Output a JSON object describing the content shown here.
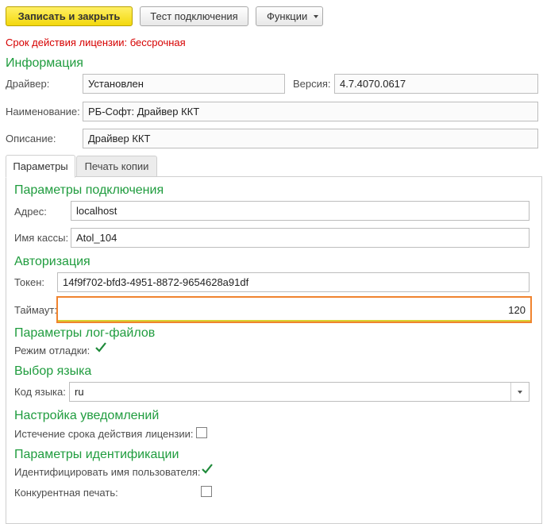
{
  "toolbar": {
    "save_close": "Записать и закрыть",
    "test_connection": "Тест подключения",
    "functions": "Функции"
  },
  "license_notice": "Срок действия лицензии: бессрочная",
  "info": {
    "title": "Информация",
    "driver_label": "Драйвер:",
    "driver_value": "Установлен",
    "version_label": "Версия:",
    "version_value": "4.7.4070.0617",
    "name_label": "Наименование:",
    "name_value": "РБ-Софт: Драйвер ККТ",
    "description_label": "Описание:",
    "description_value": "Драйвер ККТ"
  },
  "tabs": [
    {
      "label": "Параметры",
      "active": true
    },
    {
      "label": "Печать копии",
      "active": false
    }
  ],
  "params": {
    "connection": {
      "title": "Параметры подключения",
      "address_label": "Адрес:",
      "address_value": "localhost",
      "register_label": "Имя кассы:",
      "register_value": "Atol_104"
    },
    "auth": {
      "title": "Авторизация",
      "token_label": "Токен:",
      "token_value": "14f9f702-bfd3-4951-8872-9654628a91df",
      "timeout_label": "Таймаут:",
      "timeout_value": "120"
    },
    "logs": {
      "title": "Параметры лог-файлов",
      "debug_label": "Режим отладки:",
      "debug_checked": true
    },
    "language": {
      "title": "Выбор языка",
      "code_label": "Код языка:",
      "code_value": "ru"
    },
    "notifications": {
      "title": "Настройка уведомлений",
      "license_expiry_label": "Истечение срока действия лицензии:",
      "license_expiry_checked": false
    },
    "identification": {
      "title": "Параметры идентификации",
      "identify_user_label": "Идентифицировать имя пользователя:",
      "identify_user_checked": true,
      "concurrent_print_label": "Конкурентная печать:",
      "concurrent_print_checked": false
    }
  },
  "colors": {
    "section_green": "#1f9c3e",
    "notice_red": "#d60000",
    "primary_yellow": "#f3d80c",
    "focus_orange": "#f0832e",
    "check_green": "#1f8a3a"
  }
}
